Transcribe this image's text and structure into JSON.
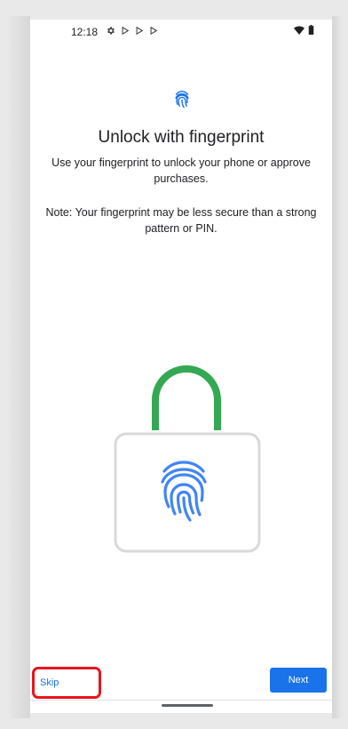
{
  "status_bar": {
    "time": "12:18",
    "left_icons": [
      "gear-icon",
      "play-store-icon",
      "play-store-icon",
      "play-store-icon"
    ],
    "right_icons": [
      "wifi-icon",
      "battery-icon"
    ]
  },
  "colors": {
    "accent": "#1a73e8",
    "lock_shackle": "#34a853",
    "lock_body": "#d9d9d9",
    "highlight": "#e8151b"
  },
  "screen": {
    "title": "Unlock with fingerprint",
    "description": "Use your fingerprint to unlock your phone or approve purchases.",
    "note": "Note: Your fingerprint may be less secure than a strong pattern or PIN."
  },
  "footer": {
    "skip_label": "Skip",
    "next_label": "Next"
  }
}
